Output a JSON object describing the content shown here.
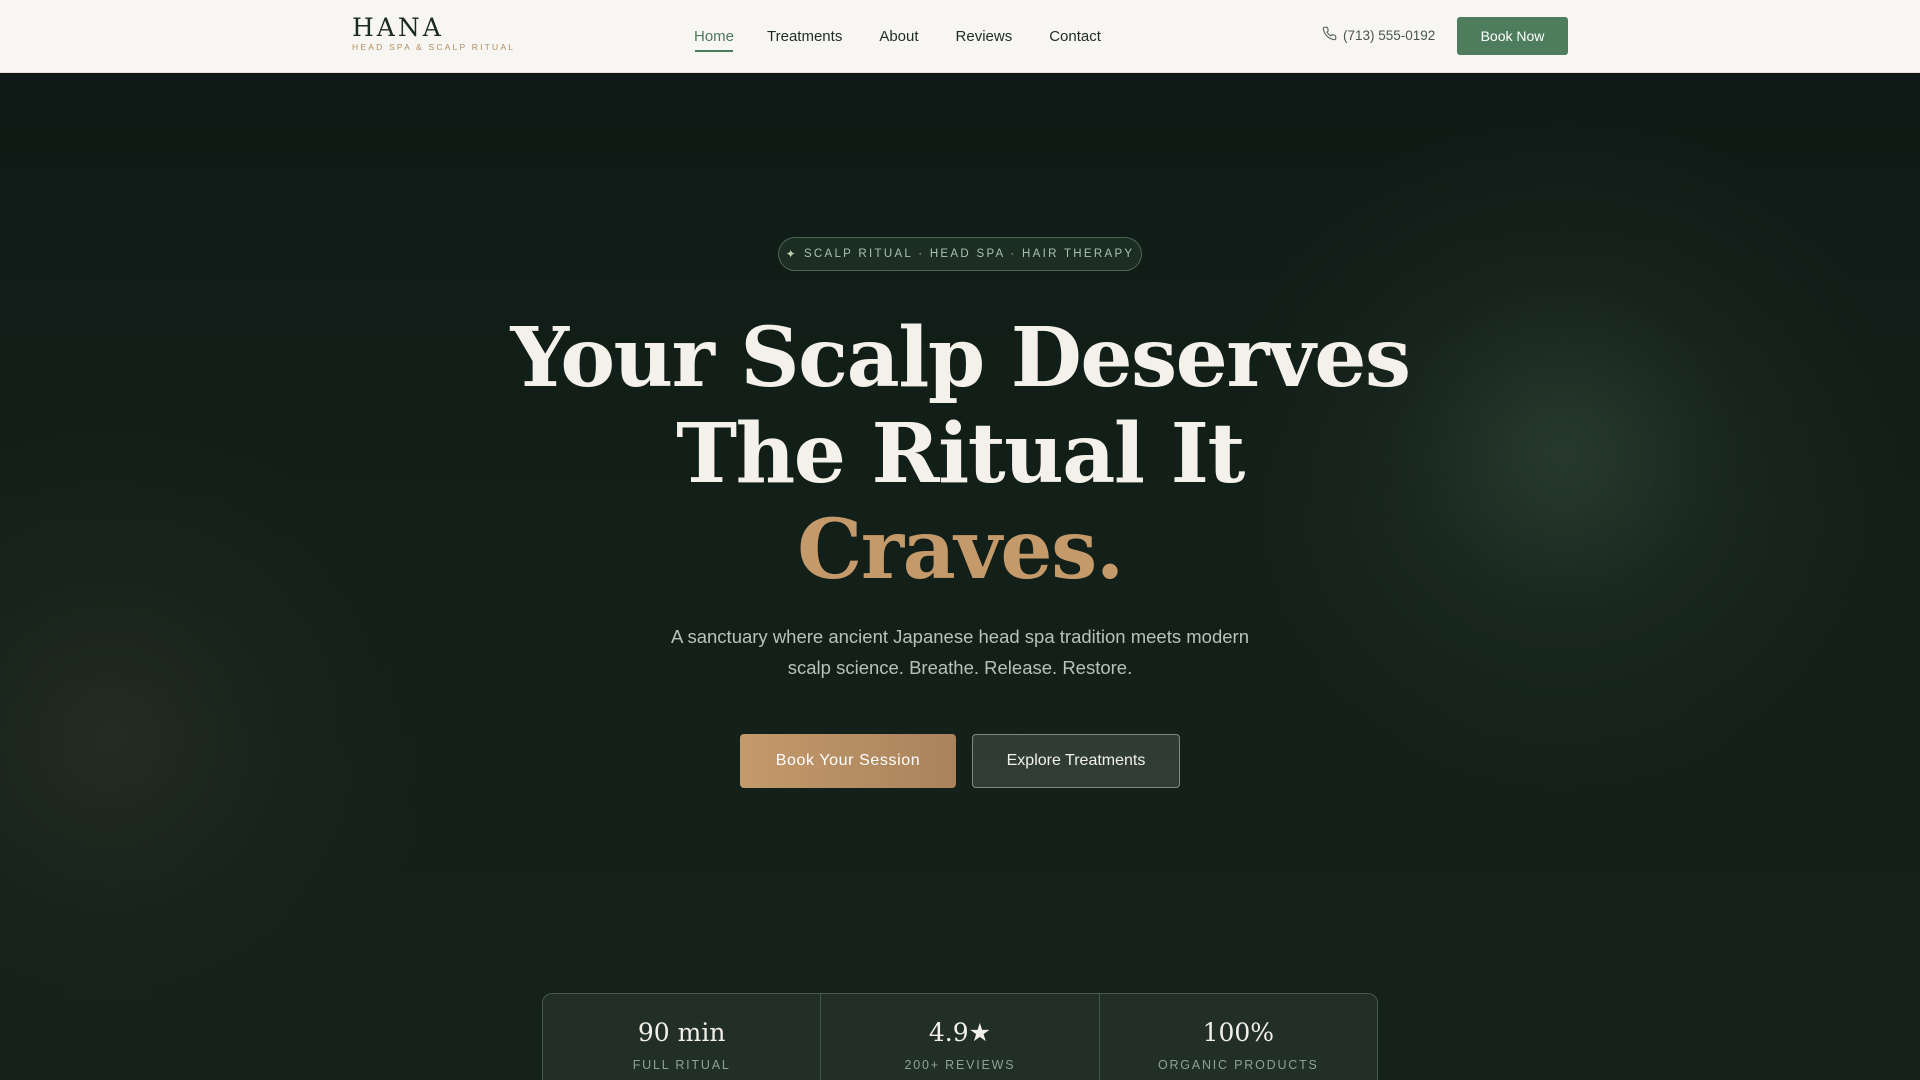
{
  "brand": {
    "name": "HANA",
    "tagline": "HEAD SPA & SCALP RITUAL"
  },
  "nav": {
    "items": [
      {
        "label": "Home",
        "active": true
      },
      {
        "label": "Treatments",
        "active": false
      },
      {
        "label": "About",
        "active": false
      },
      {
        "label": "Reviews",
        "active": false
      },
      {
        "label": "Contact",
        "active": false
      }
    ]
  },
  "header": {
    "phone": "(713) 555-0192",
    "book_label": "Book Now",
    "phone_icon": "phone-icon"
  },
  "hero": {
    "pill_star": "✦",
    "pill_text": "SCALP RITUAL · HEAD SPA · HAIR THERAPY",
    "headline_line1": "Your Scalp Deserves",
    "headline_line2": "The Ritual It",
    "headline_accent": "Craves.",
    "subtext": "A sanctuary where ancient Japanese head spa tradition meets modern scalp science. Breathe. Release. Restore.",
    "primary_cta": "Book Your Session",
    "secondary_cta": "Explore Treatments"
  },
  "stats": [
    {
      "value": "90 min",
      "label": "FULL RITUAL"
    },
    {
      "value": "4.9★",
      "label": "200+ REVIEWS"
    },
    {
      "value": "100%",
      "label": "ORGANIC PRODUCTS"
    }
  ],
  "colors": {
    "accent_green": "#4e7d5d",
    "accent_gold": "#c49a6a",
    "hero_bg": "#122019"
  }
}
